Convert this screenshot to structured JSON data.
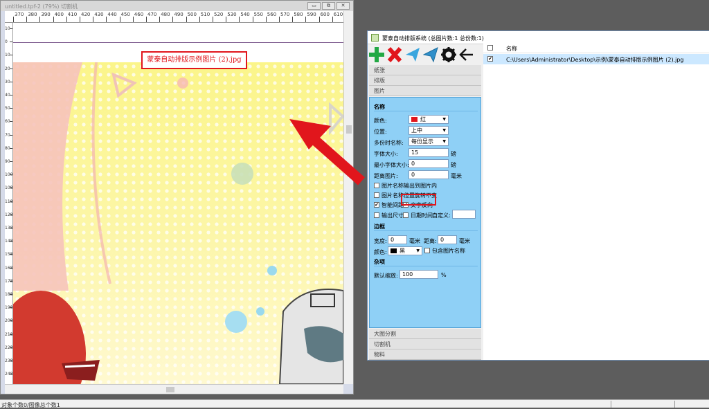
{
  "canvas_window": {
    "title": "untitled.tpf-2 (79%) 切割机",
    "buttons": [
      "▭",
      "⧉",
      "✕"
    ],
    "ruler_top": [
      "370",
      "380",
      "390",
      "400",
      "410",
      "420",
      "430",
      "440",
      "450",
      "460",
      "470",
      "480",
      "490",
      "500",
      "510",
      "520",
      "530",
      "540",
      "550",
      "560",
      "570",
      "580",
      "590",
      "600",
      "610"
    ],
    "ruler_left": [
      "10",
      "0",
      "10",
      "20",
      "30",
      "40",
      "50",
      "60",
      "70",
      "80",
      "90",
      "100",
      "108",
      "118",
      "128",
      "138",
      "148",
      "158",
      "168",
      "178",
      "188",
      "198",
      "208",
      "218",
      "228",
      "238",
      "248",
      "258"
    ],
    "image_name_label": "蒙泰自动排版示例图片 (2).jpg"
  },
  "status_bar": {
    "text": "对象个数0/图像总个数1"
  },
  "dialog": {
    "title": "蒙泰自动排版系统 (总图片数:1 总份数:1)",
    "toolbar": {
      "add": "add-icon",
      "delete": "delete-icon",
      "send": "send-icon",
      "send_outline": "send-outline-icon",
      "settings": "gear-icon",
      "back": "back-arrow-icon"
    },
    "accordion_top": [
      "纸张",
      "排版",
      "图片"
    ],
    "accordion_bottom": [
      "大图分割",
      "切割机",
      "物料"
    ],
    "name_section": {
      "title": "名称",
      "color_label": "颜色:",
      "color_value": "红",
      "color_hex": "#e1161c",
      "position_label": "位置:",
      "position_value": "上中",
      "multi_label": "多份时名称:",
      "multi_value": "每份显示",
      "font_size_label": "字体大小:",
      "font_size_value": "15",
      "font_size_unit": "磅",
      "min_font_label": "最小字体大小:",
      "min_font_value": "0",
      "min_font_unit": "磅",
      "distance_label": "距离图片:",
      "distance_value": "0",
      "distance_unit": "毫米",
      "opt_output_inside": "图片名称输出到图片内",
      "opt_position_fixed": "图片名称位置旋转不变",
      "opt_smart_gap": "智能间距",
      "opt_reverse_text": "文字反向",
      "opt_output_size": "输出尺寸",
      "opt_datetime": "日期时间",
      "custom_label": "自定义:",
      "custom_value": ""
    },
    "border_section": {
      "title": "边框",
      "width_label": "宽度:",
      "width_value": "0",
      "width_unit": "毫米",
      "distance_label": "距离:",
      "distance_value": "0",
      "distance_unit": "毫米",
      "color_label": "颜色:",
      "color_value": "黑",
      "color_hex": "#000000",
      "include_name": "包含图片名称"
    },
    "misc_section": {
      "title": "杂项",
      "zoom_label": "默认缩放:",
      "zoom_value": "100",
      "zoom_unit": "%"
    },
    "file_list": {
      "header": "名称",
      "rows": [
        "C:\\Users\\Administrator\\Desktop\\示例\\蒙泰自动排版示例图片 (2).jpg"
      ]
    }
  }
}
